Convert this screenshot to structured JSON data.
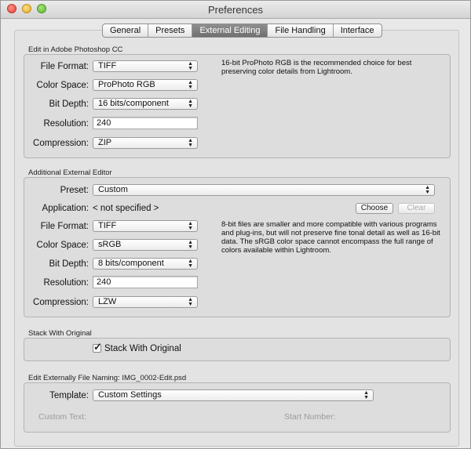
{
  "window": {
    "title": "Preferences"
  },
  "tabs": [
    {
      "label": "General",
      "active": false
    },
    {
      "label": "Presets",
      "active": false
    },
    {
      "label": "External Editing",
      "active": true
    },
    {
      "label": "File Handling",
      "active": false
    },
    {
      "label": "Interface",
      "active": false
    }
  ],
  "photoshop": {
    "title": "Edit in Adobe Photoshop CC",
    "file_format_label": "File Format:",
    "file_format": "TIFF",
    "color_space_label": "Color Space:",
    "color_space": "ProPhoto RGB",
    "bit_depth_label": "Bit Depth:",
    "bit_depth": "16 bits/component",
    "resolution_label": "Resolution:",
    "resolution": "240",
    "compression_label": "Compression:",
    "compression": "ZIP",
    "note": "16-bit ProPhoto RGB is the recommended choice for best preserving color details from Lightroom."
  },
  "additional": {
    "title": "Additional External Editor",
    "preset_label": "Preset:",
    "preset": "Custom",
    "application_label": "Application:",
    "application": "< not specified >",
    "choose_label": "Choose",
    "clear_label": "Clear",
    "file_format_label": "File Format:",
    "file_format": "TIFF",
    "color_space_label": "Color Space:",
    "color_space": "sRGB",
    "bit_depth_label": "Bit Depth:",
    "bit_depth": "8 bits/component",
    "resolution_label": "Resolution:",
    "resolution": "240",
    "compression_label": "Compression:",
    "compression": "LZW",
    "note": "8-bit files are smaller and more compatible with various programs and plug-ins, but will not preserve fine tonal detail as well as 16-bit data. The sRGB color space cannot encompass the full range of colors available within Lightroom."
  },
  "stack": {
    "title": "Stack With Original",
    "checkbox_label": "Stack With Original",
    "checked": true
  },
  "naming": {
    "title": "Edit Externally File Naming:  IMG_0002-Edit.psd",
    "template_label": "Template:",
    "template": "Custom Settings",
    "custom_text_label": "Custom Text:",
    "start_number_label": "Start Number:"
  }
}
